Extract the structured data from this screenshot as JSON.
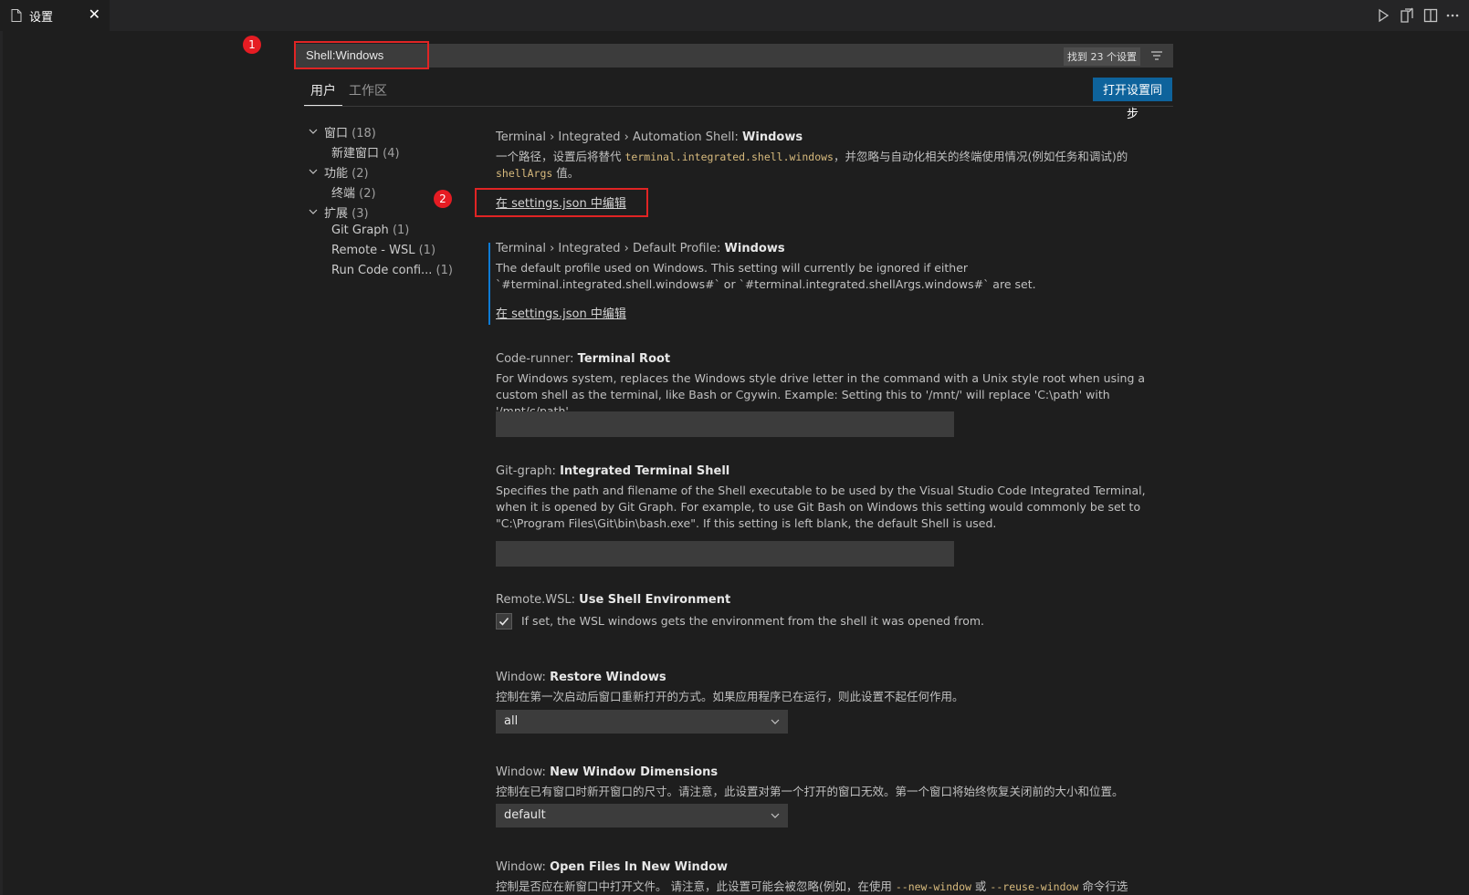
{
  "tab": {
    "title": "设置",
    "close": "✕"
  },
  "badges": [
    "1",
    "2"
  ],
  "search": {
    "value": "Shell:Windows",
    "count": "找到 23 个设置"
  },
  "scopes": {
    "user": "用户",
    "workspace": "工作区"
  },
  "sync_button": "打开设置同步",
  "toc": [
    {
      "label": "窗口",
      "count": "(18)"
    },
    {
      "label": "新建窗口",
      "count": "(4)"
    },
    {
      "label": "功能",
      "count": "(2)"
    },
    {
      "label": "终端",
      "count": "(2)"
    },
    {
      "label": "扩展",
      "count": "(3)"
    },
    {
      "label": "Git Graph",
      "count": "(1)"
    },
    {
      "label": "Remote - WSL",
      "count": "(1)"
    },
    {
      "label": "Run Code confi...",
      "count": "(1)"
    }
  ],
  "settings": {
    "s1": {
      "category": "Terminal › Integrated › Automation Shell:",
      "name": "Windows",
      "desc_a": "一个路径，设置后将替代",
      "code_a": "terminal.integrated.shell.windows",
      "desc_b": "，并忽略与自动化相关的终端使用情况(例如任务和调试)的",
      "code_b": "shellArgs",
      "desc_c": "值。",
      "link": "在 settings.json 中编辑"
    },
    "s2": {
      "category": "Terminal › Integrated › Default Profile:",
      "name": "Windows",
      "desc": "The default profile used on Windows. This setting will currently be ignored if either `#terminal.integrated.shell.windows#` or `#terminal.integrated.shellArgs.windows#` are set.",
      "link": "在 settings.json 中编辑"
    },
    "s3": {
      "category": "Code-runner:",
      "name": "Terminal Root",
      "desc": "For Windows system, replaces the Windows style drive letter in the command with a Unix style root when using a custom shell as the terminal, like Bash or Cgywin. Example: Setting this to '/mnt/' will replace 'C:\\path' with '/mnt/c/path'",
      "value": ""
    },
    "s4": {
      "category": "Git-graph:",
      "name": "Integrated Terminal Shell",
      "desc": "Specifies the path and filename of the Shell executable to be used by the Visual Studio Code Integrated Terminal, when it is opened by Git Graph. For example, to use Git Bash on Windows this setting would commonly be set to \"C:\\Program Files\\Git\\bin\\bash.exe\". If this setting is left blank, the default Shell is used.",
      "value": ""
    },
    "s5": {
      "category": "Remote.WSL:",
      "name": "Use Shell Environment",
      "desc": "If set, the WSL windows gets the environment from the shell it was opened from.",
      "checked": true
    },
    "s6": {
      "category": "Window:",
      "name": "Restore Windows",
      "desc": "控制在第一次启动后窗口重新打开的方式。如果应用程序已在运行，则此设置不起任何作用。",
      "value": "all"
    },
    "s7": {
      "category": "Window:",
      "name": "New Window Dimensions",
      "desc": "控制在已有窗口时新开窗口的尺寸。请注意，此设置对第一个打开的窗口无效。第一个窗口将始终恢复关闭前的大小和位置。",
      "value": "default"
    },
    "s8": {
      "category": "Window:",
      "name": "Open Files In New Window",
      "desc_a": "控制是否应在新窗口中打开文件。 请注意，此设置可能会被忽略(例如，在使用",
      "code_a": "--new-window",
      "desc_b": "或",
      "code_b": "--reuse-window",
      "desc_c": "命令行选"
    }
  }
}
